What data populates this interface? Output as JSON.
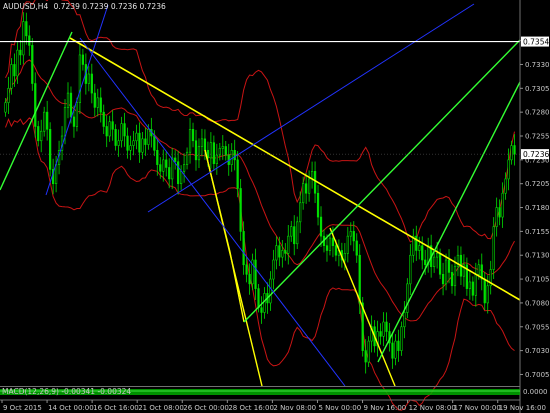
{
  "header": {
    "symbol_timeframe": "AUDUSD,H4",
    "ohlc": "0.7239 0.7239 0.7236 0.7236"
  },
  "indicator_window": {
    "label": "MACD(12,26,9) -0.00341 -0.00324",
    "right_label": "0.0000"
  },
  "colors": {
    "background": "#000000",
    "candle": "#00e000",
    "bollinger": "#c81414",
    "yellow_trend": "#ffff00",
    "green_trend": "#33ff33",
    "blue_trend": "#2233ff",
    "horizontal_line": "#ffffff",
    "axis_text": "#c8c8c8",
    "indicator": "#00aa00"
  },
  "chart_data": {
    "type": "candlestick",
    "symbol": "AUDUSD",
    "timeframe": "H4",
    "ylim": [
      0.6995,
      0.7385
    ],
    "y_ticks": [
      "0.7355",
      "0.7330",
      "0.7305",
      "0.7280",
      "0.7255",
      "0.7230",
      "0.7205",
      "0.7180",
      "0.7155",
      "0.7130",
      "0.7105",
      "0.7080",
      "0.7055",
      "0.7030",
      "0.7005"
    ],
    "x_ticks": [
      "9 Oct 2015",
      "14 Oct 00:00",
      "16 Oct 16:00",
      "21 Oct 08:00",
      "26 Oct 00:00",
      "28 Oct 16:00",
      "2 Nov 08:00",
      "5 Nov 00:00",
      "9 Nov 16:00",
      "12 Nov 08:00",
      "17 Nov 00:00",
      "19 Nov 16:00"
    ],
    "current_price": "0.7236",
    "horizontal_line_price": "0.7354",
    "horizontal_line_label": "0.7354",
    "closes": [
      0.729,
      0.7305,
      0.733,
      0.7318,
      0.7345,
      0.734,
      0.7375,
      0.736,
      0.735,
      0.731,
      0.7265,
      0.725,
      0.726,
      0.728,
      0.7262,
      0.722,
      0.7205,
      0.7225,
      0.724,
      0.7255,
      0.7285,
      0.73,
      0.7275,
      0.7265,
      0.729,
      0.734,
      0.733,
      0.731,
      0.732,
      0.73,
      0.7285,
      0.7295,
      0.728,
      0.7265,
      0.7255,
      0.727,
      0.7262,
      0.7245,
      0.725,
      0.7268,
      0.7255,
      0.724,
      0.7245,
      0.725,
      0.7258,
      0.7238,
      0.7252,
      0.7246,
      0.7262,
      0.7255,
      0.724,
      0.7225,
      0.7218,
      0.723,
      0.7222,
      0.721,
      0.7232,
      0.7228,
      0.7205,
      0.7218,
      0.7225,
      0.7238,
      0.7262,
      0.725,
      0.723,
      0.7244,
      0.7252,
      0.724,
      0.7232,
      0.7248,
      0.7226,
      0.7235,
      0.7242,
      0.7244,
      0.7235,
      0.7225,
      0.724,
      0.723,
      0.72,
      0.7155,
      0.712,
      0.711,
      0.71,
      0.7125,
      0.7095,
      0.7075,
      0.707,
      0.709,
      0.708,
      0.7105,
      0.7125,
      0.714,
      0.7128,
      0.7135,
      0.7132,
      0.715,
      0.716,
      0.7142,
      0.7165,
      0.7185,
      0.7205,
      0.7195,
      0.721,
      0.7218,
      0.7195,
      0.717,
      0.715,
      0.714,
      0.7135,
      0.7148,
      0.714,
      0.713,
      0.7135,
      0.7125,
      0.7132,
      0.715,
      0.7155,
      0.7145,
      0.713,
      0.708,
      0.703,
      0.7018,
      0.704,
      0.7055,
      0.7035,
      0.705,
      0.7045,
      0.706,
      0.705,
      0.7038,
      0.7022,
      0.704,
      0.703,
      0.7055,
      0.707,
      0.71,
      0.713,
      0.715,
      0.7135,
      0.714,
      0.7125,
      0.712,
      0.714,
      0.7118,
      0.7128,
      0.7132,
      0.711,
      0.71,
      0.7125,
      0.7112,
      0.7098,
      0.7118,
      0.713,
      0.7108,
      0.712,
      0.7095,
      0.7102,
      0.7088,
      0.711,
      0.712,
      0.7105,
      0.708,
      0.7098,
      0.7115,
      0.716,
      0.718,
      0.717,
      0.7195,
      0.721,
      0.723,
      0.7245,
      0.7236
    ]
  }
}
